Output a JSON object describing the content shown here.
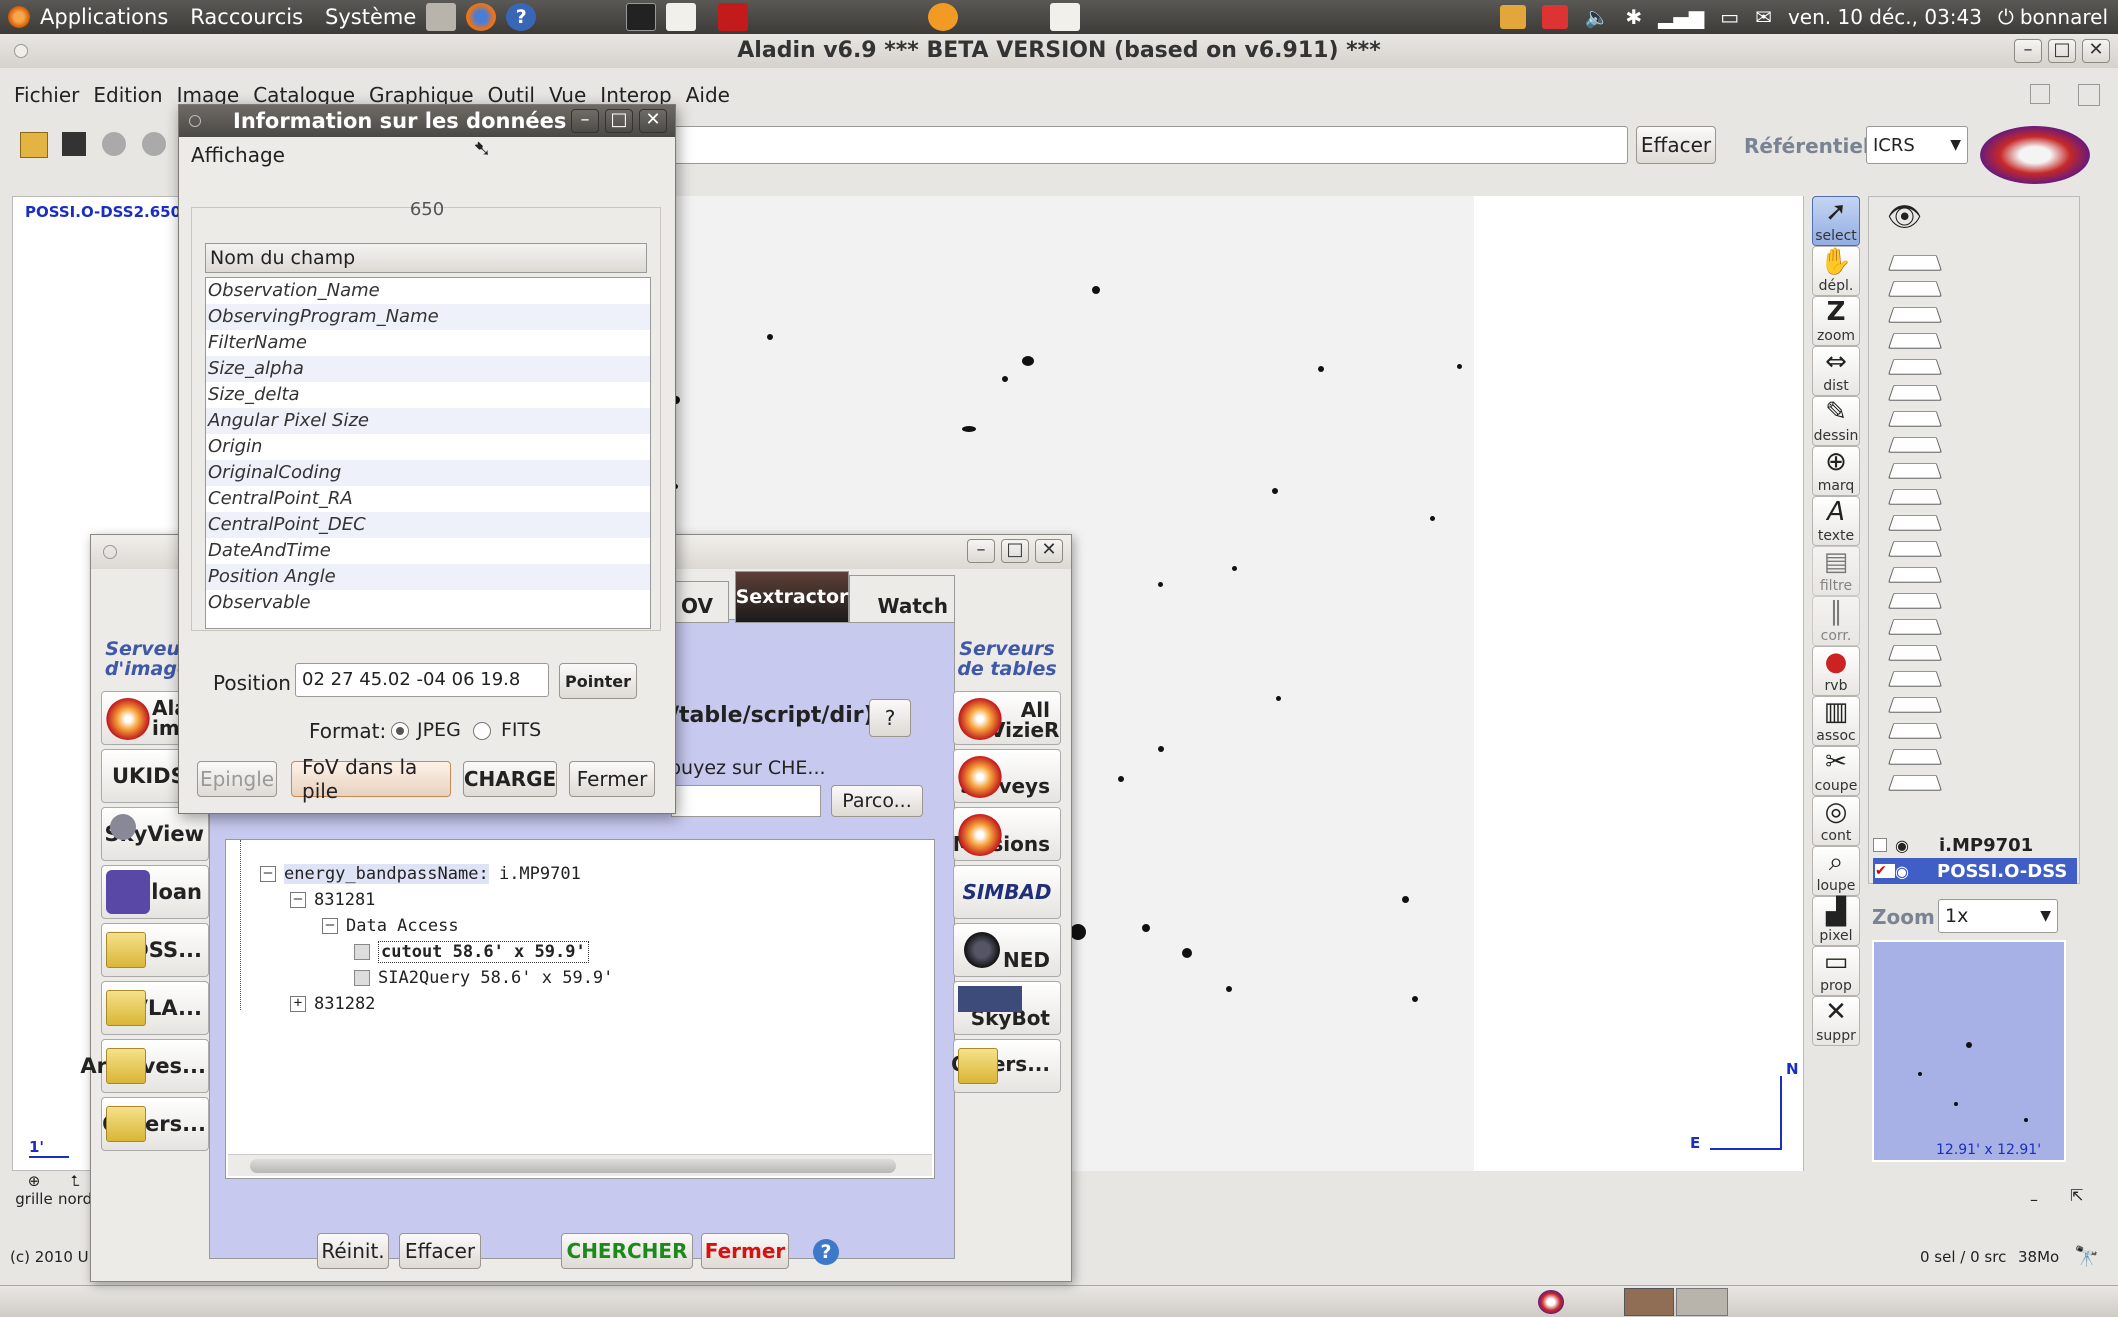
{
  "panel": {
    "menus": [
      "Applications",
      "Raccourcis",
      "Système"
    ],
    "clock": "ven. 10 déc., 03:43",
    "user": "bonnarel"
  },
  "aladin": {
    "title": "Aladin v6.9      *** BETA VERSION (based on v6.911) ***",
    "menu": [
      "Fichier",
      "Edition",
      "Image",
      "Catalogue",
      "Graphique",
      "Outil",
      "Vue",
      "Interop",
      "Aide"
    ],
    "effacer_label": "Effacer",
    "referentiel_label": "Référentiel",
    "referentiel_value": "ICRS",
    "view_label": "POSSI.O-DSS2.650",
    "scale_label": "1'",
    "compass_n": "N",
    "compass_e": "E",
    "grille_label": "grille",
    "nord_label": "nord",
    "copyright": "(c) 2010 U",
    "tools": [
      "select",
      "dépl.",
      "zoom",
      "dist",
      "dessin",
      "marq",
      "texte",
      "filtre",
      "corr.",
      "rvb",
      "assoc",
      "coupe",
      "cont",
      "loupe",
      "pixel",
      "prop",
      "suppr"
    ],
    "planes": [
      "i.MP9701",
      "POSSI.O-DSS"
    ],
    "zoom_label": "Zoom",
    "zoom_value": "1x",
    "thumb_caption": "12.91' x 12.91'",
    "status_right": "0 sel / 0 src",
    "memory": "38Mo"
  },
  "server_dialog": {
    "image_servers_title": "Serveurs d'images",
    "table_servers_title": "Serveurs de tables",
    "image_servers": [
      "Aladin image",
      "UKIDS",
      "SkyView",
      "Sloan",
      "DSS...",
      "VLA...",
      "Archives...",
      "Others..."
    ],
    "table_servers": [
      "All VizieR",
      "Surveys",
      "Missions",
      "SIMBAD",
      "NED",
      "SkyBot",
      "Others..."
    ],
    "tabs": [
      "OV",
      "Sextractor",
      "Watch"
    ],
    "target_hint": "/table/script/dir)",
    "help_q": "?",
    "hint_text": "puyez sur CHE...",
    "browse_label": "Parco...",
    "tree": {
      "root_key": "energy_bandpassName:",
      "root_value": "i.MP9701",
      "node1": "831281",
      "data_access": "Data Access",
      "cutout": "cutout 58.6' x 59.9'",
      "sia2": "SIA2Query 58.6' x 59.9'",
      "node2": "831282"
    },
    "buttons": {
      "reinit": "Réinit.",
      "effacer": "Effacer",
      "chercher": "CHERCHER",
      "fermer": "Fermer"
    }
  },
  "info_dialog": {
    "title": "Information sur les données",
    "menu": "Affichage",
    "group_title": "650",
    "column_header": "Nom du champ",
    "fields": [
      "Observation_Name",
      "ObservingProgram_Name",
      "FilterName",
      "Size_alpha",
      "Size_delta",
      "Angular Pixel Size",
      "Origin",
      "OriginalCoding",
      "CentralPoint_RA",
      "CentralPoint_DEC",
      "DateAndTime",
      "Position Angle",
      "Observable"
    ],
    "position_label": "Position",
    "position_value": "02 27 45.02 -04 06 19.8",
    "pointer_label": "Pointer",
    "format_label": "Format:",
    "format_jpeg": "JPEG",
    "format_fits": "FITS",
    "format_selected": "JPEG",
    "buttons": {
      "epingle": "Epingle",
      "fov": "FoV dans la pile",
      "charge": "CHARGE",
      "fermer": "Fermer"
    }
  },
  "colors": {
    "chercher": "#1b8a1b",
    "fermer_red": "#d81010",
    "plane_selected": "#3f5fc7",
    "view_label": "#1a2fbf"
  }
}
